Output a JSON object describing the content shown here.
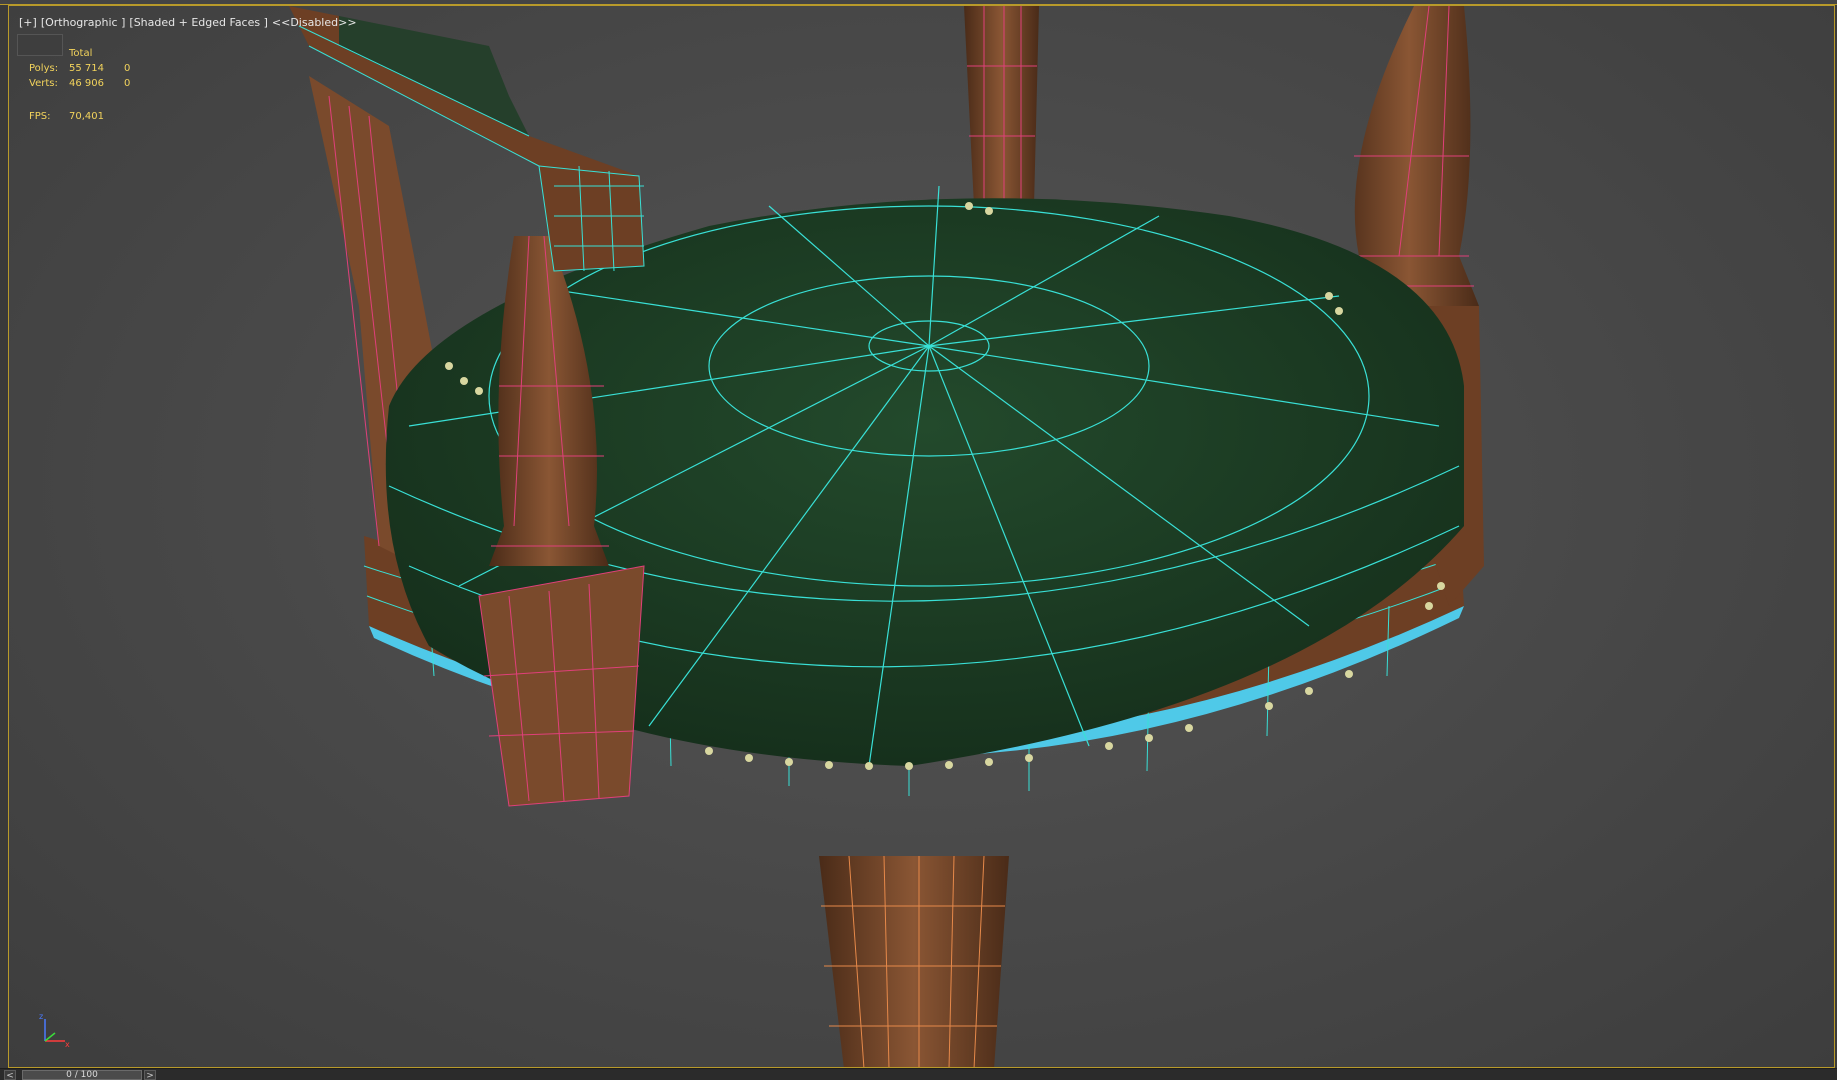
{
  "viewport": {
    "menu_plus": "[+]",
    "view_mode": "[Orthographic ]",
    "shading_mode": "[Shaded + Edged Faces ]",
    "disabled_label": "<<Disabled>>"
  },
  "stats": {
    "total_label": "Total",
    "polys_label": "Polys:",
    "polys_value": "55 714",
    "polys_sel": "0",
    "verts_label": "Verts:",
    "verts_value": "46 906",
    "verts_sel": "0",
    "fps_label": "FPS:",
    "fps_value": "70,401"
  },
  "gizmo": {
    "z_label": "z",
    "x_label": "x",
    "icon": "axis-tripod-icon"
  },
  "timeline": {
    "prev_label": "<",
    "frame_label": "0 / 100",
    "next_label": ">"
  },
  "colors": {
    "wood": "#7a4a2c",
    "cushion": "#1f3d26",
    "wire_cyan": "#39e0d6",
    "wire_pink": "#e0407a",
    "wire_orange": "#e6894a",
    "frame_border": "#b89a2a",
    "stats_text": "#f2d35c"
  }
}
